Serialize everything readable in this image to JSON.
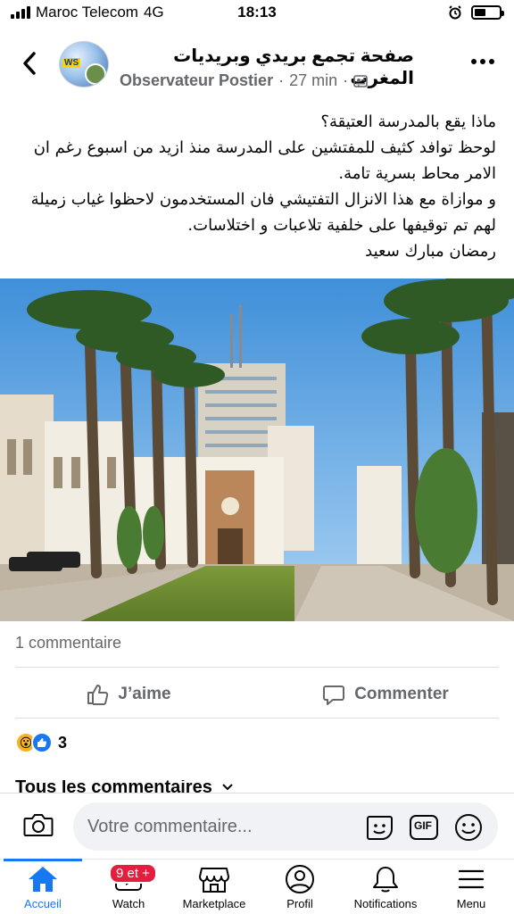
{
  "status_bar": {
    "carrier": "Maroc Telecom",
    "network": "4G",
    "time": "18:13",
    "battery_level": 0.45
  },
  "header": {
    "page_name": "صفحة تجمع بريدي وبريديات المغرب",
    "author": "Observateur Postier",
    "time_ago": "27 min",
    "avatar_tag": "WS"
  },
  "post": {
    "lines": [
      "ماذا يقع بالمدرسة العتيقة؟",
      "لوحظ توافد كثيف للمفتشين على المدرسة منذ ازيد من اسبوع رغم ان الامر محاط بسرية تامة.",
      "و موازاة مع هذا الانزال التفتيشي فان  المستخدمون لاحظوا غياب زميلة لهم تم توقيفها  على خلفية تلاعبات و اختلاسات.",
      "رمضان مبارك سعيد"
    ]
  },
  "engagement": {
    "comment_count": "1 commentaire",
    "like_label": "J’aime",
    "comment_label": "Commenter",
    "reaction_count": "3",
    "all_comments_label": "Tous les commentaires"
  },
  "composer": {
    "placeholder": "Votre commentaire...",
    "gif_label": "GIF"
  },
  "tabbar": {
    "tabs": [
      {
        "label": "Accueil",
        "icon": "home-icon",
        "active": true
      },
      {
        "label": "Watch",
        "icon": "watch-icon",
        "badge": "9 et +"
      },
      {
        "label": "Marketplace",
        "icon": "marketplace-icon"
      },
      {
        "label": "Profil",
        "icon": "profile-icon"
      },
      {
        "label": "Notifications",
        "icon": "bell-icon"
      },
      {
        "label": "Menu",
        "icon": "menu-icon"
      }
    ]
  },
  "colors": {
    "accent": "#1877f2",
    "badge": "#e41e3f",
    "secondary_text": "#65676b"
  }
}
